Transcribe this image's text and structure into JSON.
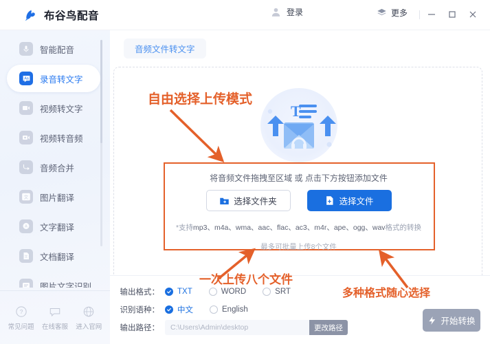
{
  "window": {
    "app_title": "布谷鸟配音",
    "logo_icon": "bird-logo-icon",
    "account": {
      "icon": "avatar-icon",
      "label": "登录"
    },
    "more": {
      "icon": "layers-icon",
      "label": "更多"
    },
    "controls": {
      "minimize": "minimize-icon",
      "maximize": "maximize-icon",
      "close": "close-icon"
    }
  },
  "sidebar": {
    "items": [
      {
        "label": "智能配音",
        "icon": "mic-icon",
        "active": false
      },
      {
        "label": "录音转文字",
        "icon": "speech-text-icon",
        "active": true
      },
      {
        "label": "视频转文字",
        "icon": "video-text-icon",
        "active": false
      },
      {
        "label": "视频转音频",
        "icon": "video-audio-icon",
        "active": false
      },
      {
        "label": "音频合并",
        "icon": "merge-icon",
        "active": false
      },
      {
        "label": "图片翻译",
        "icon": "image-translate-icon",
        "active": false
      },
      {
        "label": "文字翻译",
        "icon": "text-translate-icon",
        "active": false
      },
      {
        "label": "文档翻译",
        "icon": "doc-translate-icon",
        "active": false
      },
      {
        "label": "图片文字识别",
        "icon": "ocr-icon",
        "active": false
      }
    ],
    "help": [
      {
        "label": "常见问题",
        "icon": "question-circle-icon"
      },
      {
        "label": "在线客服",
        "icon": "chat-bubble-icon"
      },
      {
        "label": "进入官网",
        "icon": "globe-cloud-icon"
      }
    ]
  },
  "main": {
    "tabs": [
      {
        "label": "音频文件转文字",
        "active": true
      }
    ],
    "dropzone": {
      "illustration_icon": "envelope-audio-text-icon",
      "hint": "将音频文件拖拽至区域 或 点击下方按钮添加文件",
      "folder_button": {
        "label": "选择文件夹",
        "icon": "folder-plus-icon"
      },
      "file_button": {
        "label": "选择文件",
        "icon": "file-plus-icon"
      },
      "formats_prefix": "*支持",
      "formats": "mp3、m4a、wma、aac、flac、ac3、m4r、ape、ogg、wav",
      "formats_suffix": "格式的转换",
      "limit": "最多可批量上传8个文件"
    }
  },
  "annotations": {
    "color": "#e4602a",
    "items": [
      {
        "text": "自由选择上传模式"
      },
      {
        "text": "一次上传八个文件"
      },
      {
        "text": "多种格式随心选择"
      }
    ]
  },
  "settings": {
    "output_format": {
      "label": "输出格式：",
      "options": [
        {
          "label": "TXT",
          "selected": true
        },
        {
          "label": "WORD",
          "selected": false
        },
        {
          "label": "SRT",
          "selected": false
        }
      ]
    },
    "language": {
      "label": "识别语种：",
      "options": [
        {
          "label": "中文",
          "selected": true
        },
        {
          "label": "English",
          "selected": false
        }
      ]
    },
    "output_path": {
      "label": "输出路径：",
      "value": "C:\\Users\\Admin\\desktop",
      "placeholder": "C:\\Users\\Admin\\desktop",
      "change_button": "更改路径"
    },
    "convert_button": {
      "label": "开始转换",
      "icon": "lightning-icon"
    }
  },
  "colors": {
    "accent_blue": "#1a6fe0",
    "annotation_orange": "#e4602a",
    "sidebar_bg": "#eef3fc",
    "disabled_gray": "#9ba3b6"
  }
}
